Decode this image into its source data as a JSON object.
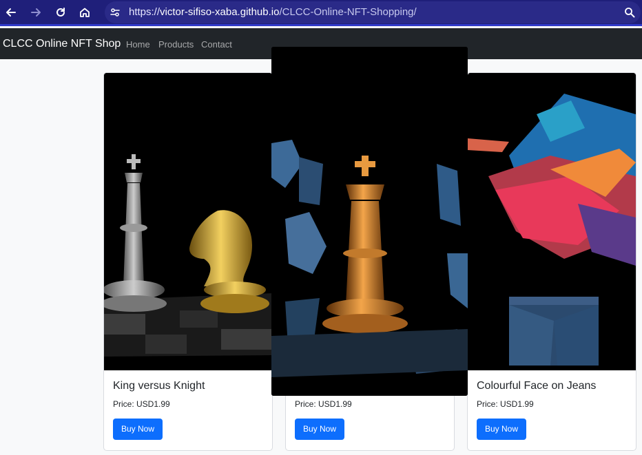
{
  "browser": {
    "url_prefix": "https://",
    "url_host": "victor-sifiso-xaba.github.io",
    "url_path": "/CLCC-Online-NFT-Shopping/",
    "icons": [
      "back-arrow-icon",
      "forward-arrow-icon",
      "reload-icon",
      "home-icon",
      "site-settings-icon",
      "zoom-icon"
    ]
  },
  "navbar": {
    "brand": "CLCC Online NFT Shop",
    "links": [
      "Home",
      "Products",
      "Contact"
    ]
  },
  "products": [
    {
      "title": "King versus Knight",
      "price": "Price: USD1.99",
      "button": "Buy Now"
    },
    {
      "title": "",
      "price": "Price: USD1.99",
      "button": "Buy Now"
    },
    {
      "title": "Colourful Face on Jeans",
      "price": "Price: USD1.99",
      "button": "Buy Now"
    }
  ]
}
